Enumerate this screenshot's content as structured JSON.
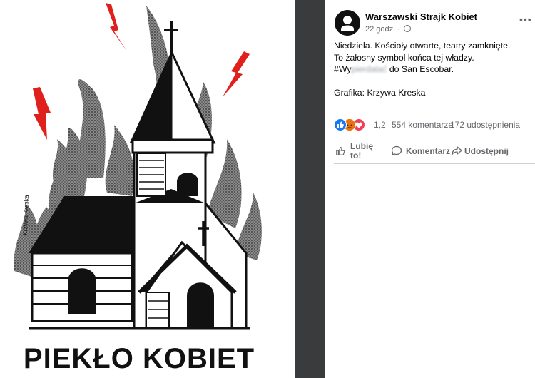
{
  "artwork": {
    "signature": "Krzywa Kreska",
    "title": "PIEKŁO KOBIET",
    "colors": {
      "lightning": "#e0201c",
      "ink": "#111111",
      "smoke": "#555555"
    }
  },
  "post": {
    "page_name": "Warszawski Strajk Kobiet",
    "time": "22 godz.",
    "avatar_icon": "wsk-logo-icon",
    "text_line1": "Niedziela. Kościoły otwarte, teatry zamknięte.",
    "text_line2": "To żałosny symbol końca tej władzy.",
    "hashtag_visible": "#Wy",
    "hashtag_blurred": "pierdalać",
    "text_line3_rest": " do San Escobar.",
    "credit": "Grafika: Krzywa Kreska",
    "reactions": {
      "icons": [
        "like-reaction-icon",
        "angry-reaction-icon",
        "love-reaction-icon"
      ],
      "count": "1,2",
      "comments": "554 komentarze",
      "shares": "172 udostępnienia"
    },
    "actions": {
      "like": "Lubię to!",
      "comment": "Komentarz",
      "share": "Udostępnij"
    }
  }
}
